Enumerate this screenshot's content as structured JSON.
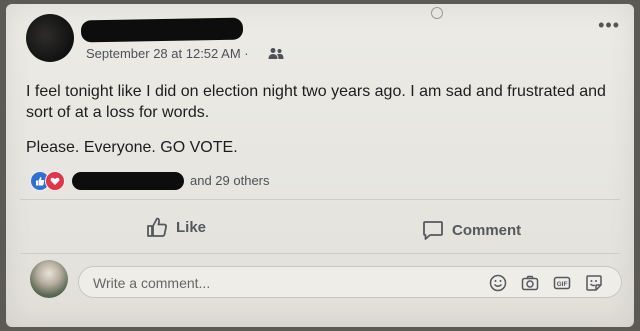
{
  "post": {
    "timestamp": "September 28 at 12:52 AM ·",
    "privacy_icon": "friends-icon",
    "paragraphs": [
      "I feel tonight like I did on election night two years ago. I am sad and frustrated and sort of at a loss for words.",
      "Please. Everyone. GO VOTE."
    ]
  },
  "reactions": {
    "icons": [
      "like-reaction-icon",
      "love-reaction-icon"
    ],
    "count_text": "and 29 others"
  },
  "actions": {
    "like_label": "Like",
    "comment_label": "Comment"
  },
  "comment_input": {
    "placeholder": "Write a comment...",
    "icons": [
      "emoji-icon",
      "camera-icon",
      "gif-icon",
      "sticker-icon"
    ]
  },
  "colors": {
    "like_blue": "#2f6fd6",
    "love_red": "#e0364a",
    "card_bg": "#ecebe6"
  }
}
